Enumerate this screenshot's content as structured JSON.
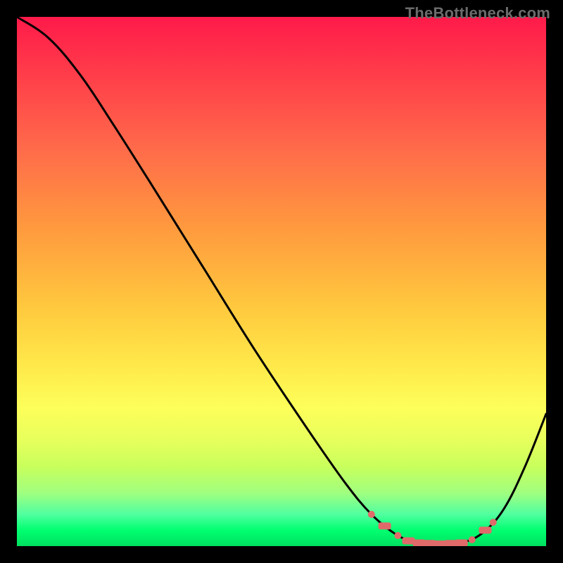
{
  "watermark": "TheBottleneck.com",
  "chart_data": {
    "type": "line",
    "title": "",
    "xlabel": "",
    "ylabel": "",
    "xlim": [
      0,
      100
    ],
    "ylim": [
      0,
      100
    ],
    "grid": false,
    "legend": false,
    "curve": [
      {
        "x": 0,
        "y": 100
      },
      {
        "x": 6,
        "y": 96
      },
      {
        "x": 12,
        "y": 89
      },
      {
        "x": 18,
        "y": 80
      },
      {
        "x": 25,
        "y": 69
      },
      {
        "x": 35,
        "y": 53
      },
      {
        "x": 45,
        "y": 37
      },
      {
        "x": 55,
        "y": 22
      },
      {
        "x": 62,
        "y": 12
      },
      {
        "x": 67,
        "y": 6
      },
      {
        "x": 72,
        "y": 2
      },
      {
        "x": 76,
        "y": 0.6
      },
      {
        "x": 80,
        "y": 0.4
      },
      {
        "x": 84,
        "y": 0.6
      },
      {
        "x": 88,
        "y": 2.5
      },
      {
        "x": 92,
        "y": 7
      },
      {
        "x": 96,
        "y": 15
      },
      {
        "x": 100,
        "y": 25
      }
    ],
    "markers": [
      {
        "x": 67,
        "y": 6,
        "shape": "dot"
      },
      {
        "x": 69.5,
        "y": 3.8,
        "shape": "rect"
      },
      {
        "x": 72,
        "y": 2,
        "shape": "dot"
      },
      {
        "x": 74,
        "y": 1,
        "shape": "rect"
      },
      {
        "x": 76,
        "y": 0.6,
        "shape": "rect"
      },
      {
        "x": 78,
        "y": 0.5,
        "shape": "rect"
      },
      {
        "x": 80,
        "y": 0.4,
        "shape": "rect"
      },
      {
        "x": 82,
        "y": 0.5,
        "shape": "rect"
      },
      {
        "x": 84,
        "y": 0.6,
        "shape": "rect"
      },
      {
        "x": 86,
        "y": 1.2,
        "shape": "dot"
      },
      {
        "x": 88.5,
        "y": 3,
        "shape": "rect"
      },
      {
        "x": 90,
        "y": 4.5,
        "shape": "dot"
      }
    ]
  }
}
